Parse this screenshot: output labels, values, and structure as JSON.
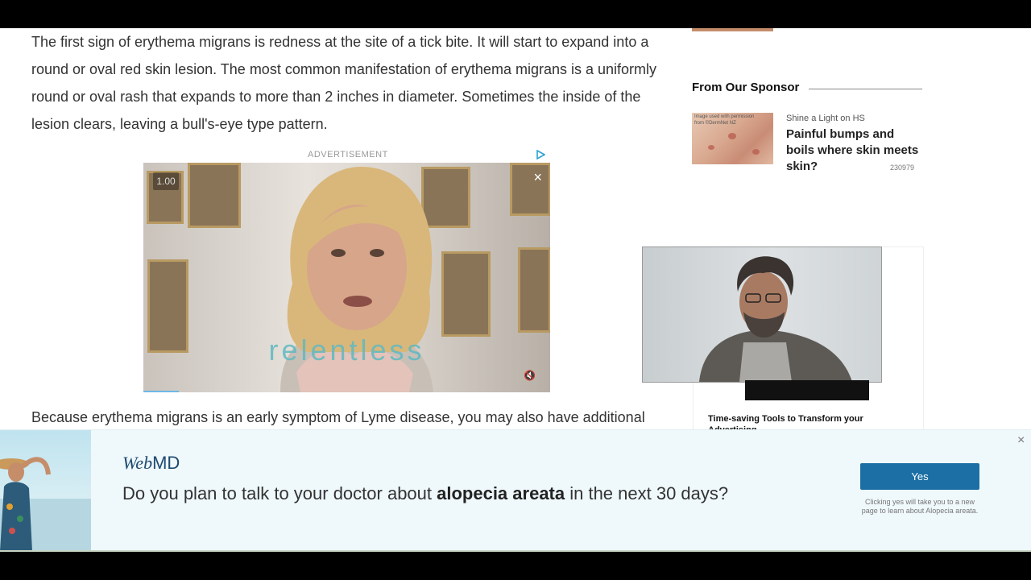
{
  "article": {
    "paragraph1": "The first sign of erythema migrans is redness at the site of a tick bite. It will start to expand into a round or oval red skin lesion. The most common manifestation of erythema migrans is a uniformly round or oval rash that expands to more than 2 inches in diameter. Sometimes the inside of the lesion clears, leaving a bull's-eye type pattern.",
    "paragraph2": "Because erythema migrans is an early symptom of Lyme disease, you may also have additional"
  },
  "video_ad": {
    "label": "ADVERTISEMENT",
    "counter": "1.00",
    "close": "×",
    "overlay_text": "relentless"
  },
  "sidebar": {
    "sponsor_heading": "From Our Sponsor",
    "sponsor_image_caption": "Image used with permission from ©DermNet NZ",
    "sponsor_kicker": "Shine a Light on HS",
    "sponsor_title": "Painful bumps and boils where skin meets skin?",
    "sponsor_id": "230979",
    "card_title": "Time-saving Tools to Transform your Advertising"
  },
  "banner": {
    "logo_web": "Web",
    "logo_md": "MD",
    "question_pre": "Do you plan to talk to your doctor about ",
    "question_bold": "alopecia areata",
    "question_post": " in the next 30 days?",
    "yes_label": "Yes",
    "note": "Clicking yes will take you to a new page to learn about Alopecia areata.",
    "close": "×"
  },
  "colors": {
    "brand_blue": "#1b6fa5",
    "banner_bg": "#eff8fb",
    "logo_blue": "#1d4a70"
  }
}
